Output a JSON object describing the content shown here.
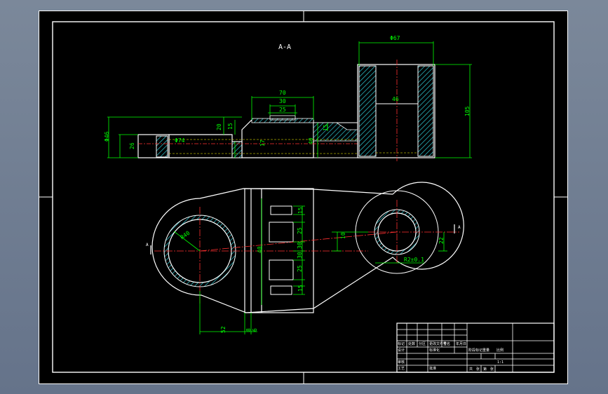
{
  "colors": {
    "background": "#6f7d8f",
    "sheet": "#000000",
    "border": "#ffffff",
    "outline": "#ffffff",
    "dimension": "#00ff00",
    "hatch": "#00c0c0",
    "centerline": "#ff3030",
    "hidden": "#ffff00"
  },
  "section": {
    "title": "A-A",
    "dims": [
      "Φ67",
      "70",
      "30",
      "25",
      "20",
      "15",
      "17",
      "40",
      "15",
      "46",
      "26",
      "Φ74",
      "Φ46",
      "105"
    ]
  },
  "plan": {
    "dims": [
      "R40",
      "40",
      "15",
      "25",
      "30",
      "30",
      "25",
      "15",
      "10",
      "22",
      "R2±0.1",
      "8",
      "6",
      "52"
    ],
    "marks": [
      "A",
      "A"
    ]
  },
  "title_block": {
    "cells": [
      "标记",
      "处数",
      "分区",
      "更改文件号",
      "签名",
      "年月日",
      "设计",
      "标准化",
      "阶段标记",
      "重量",
      "比例",
      "审核",
      "工艺",
      "批准",
      "共",
      "张",
      "第",
      "张",
      "1:1"
    ]
  }
}
